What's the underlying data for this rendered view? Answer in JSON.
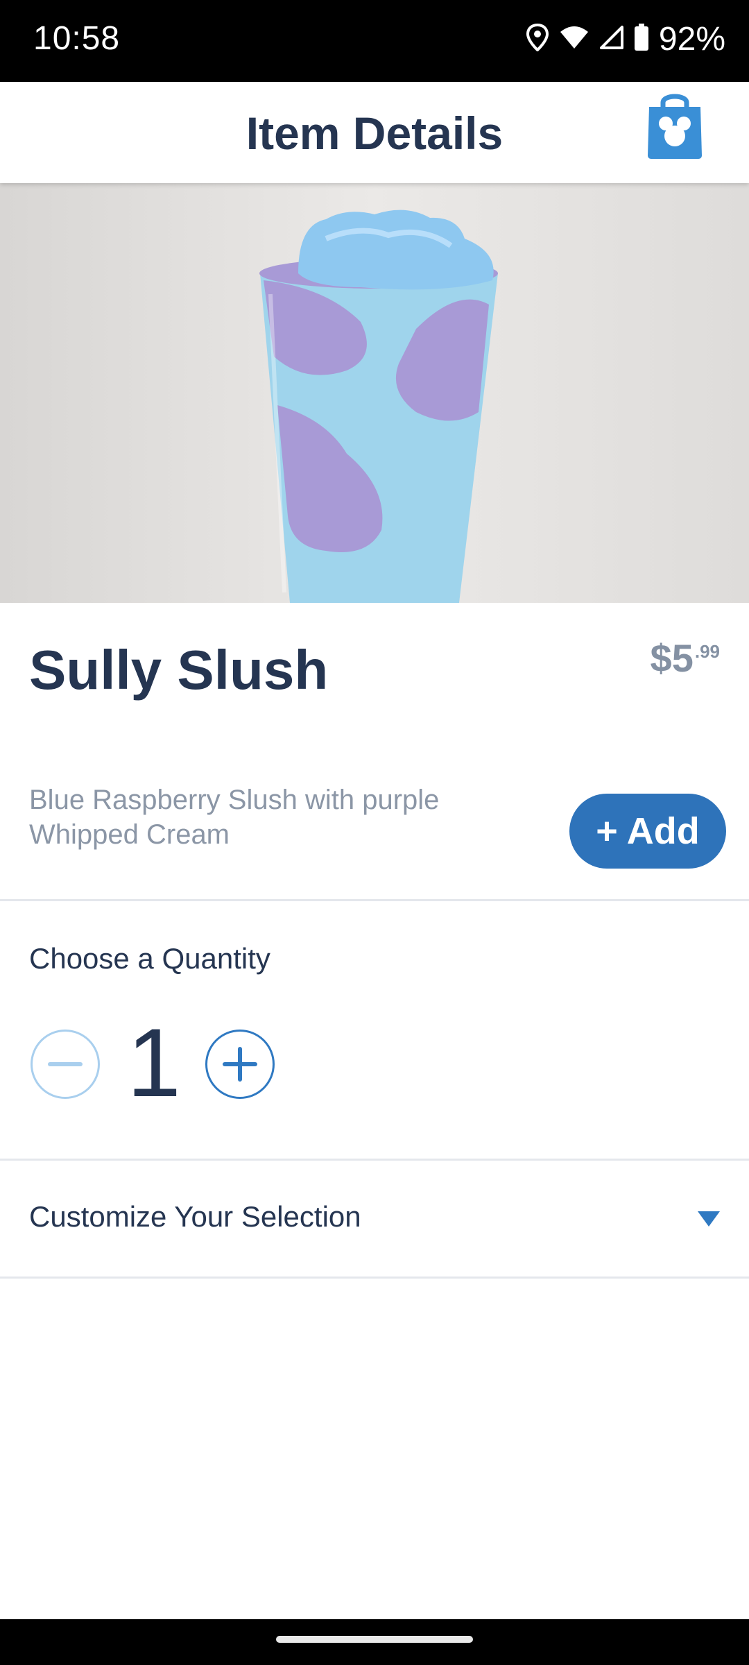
{
  "status_bar": {
    "time": "10:58",
    "battery_percent": "92%",
    "icons": [
      "location-icon",
      "wifi-icon",
      "signal-icon",
      "battery-icon"
    ]
  },
  "header": {
    "title": "Item Details",
    "bag_icon": "mickey-shopping-bag-icon"
  },
  "item": {
    "name": "Sully Slush",
    "price_main": "$5",
    "price_cents": ".99",
    "description": "Blue Raspberry Slush with purple Whipped Cream",
    "add_label": "+ Add"
  },
  "quantity": {
    "label": "Choose a Quantity",
    "value": "1"
  },
  "customize": {
    "label": "Customize Your Selection"
  },
  "colors": {
    "accent": "#2e73ba",
    "title_text": "#253551",
    "muted_text": "#8b96a6",
    "divider": "#e4e7ec"
  }
}
